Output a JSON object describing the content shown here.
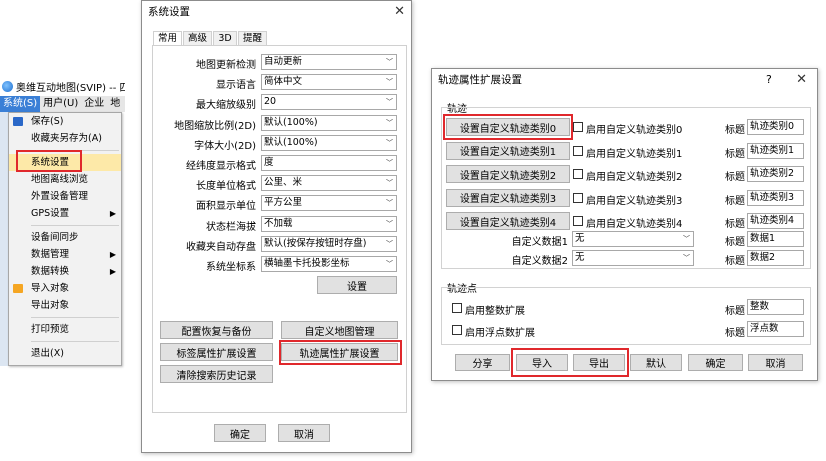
{
  "app": {
    "title": "奥维互动地图(SVIP) -- 四",
    "menubar": [
      "系统(S)",
      "用户(U)",
      "企业",
      "地"
    ]
  },
  "menu": {
    "items": [
      {
        "label": "保存(S)",
        "icon": "save-icon"
      },
      {
        "label": "收藏夹另存为(A)"
      },
      {
        "label": "系统设置"
      },
      {
        "label": "地图离线浏览"
      },
      {
        "label": "外置设备管理"
      },
      {
        "label": "GPS设置",
        "submenu": true
      },
      {
        "label": "设备间同步"
      },
      {
        "label": "数据管理",
        "submenu": true
      },
      {
        "label": "数据转换",
        "submenu": true
      },
      {
        "label": "导入对象",
        "icon": "import-icon"
      },
      {
        "label": "导出对象"
      },
      {
        "label": "打印预览"
      },
      {
        "label": "退出(X)"
      }
    ]
  },
  "sys": {
    "title": "系统设置",
    "close": "✕",
    "tabs": [
      "常用",
      "高级",
      "3D",
      "提醒"
    ],
    "rows": [
      {
        "label": "地图更新检测",
        "value": "自动更新"
      },
      {
        "label": "显示语言",
        "value": "简体中文"
      },
      {
        "label": "最大缩放级别",
        "value": "20"
      },
      {
        "label": "地图缩放比例(2D)",
        "value": "默认(100%)"
      },
      {
        "label": "字体大小(2D)",
        "value": "默认(100%)"
      },
      {
        "label": "经纬度显示格式",
        "value": "度"
      },
      {
        "label": "长度单位格式",
        "value": "公里、米"
      },
      {
        "label": "面积显示单位",
        "value": "平方公里"
      },
      {
        "label": "状态栏海拔",
        "value": "不加载"
      },
      {
        "label": "收藏夹自动存盘",
        "value": "默认(按保存按钮时存盘)"
      },
      {
        "label": "系统坐标系",
        "value": "横轴墨卡托投影坐标"
      }
    ],
    "setting_btn": "设置",
    "btns": [
      "配置恢复与备份",
      "自定义地图管理",
      "标签属性扩展设置",
      "轨迹属性扩展设置",
      "清除搜索历史记录"
    ],
    "ok": "确定",
    "cancel": "取消"
  },
  "track": {
    "title": "轨迹属性扩展设置",
    "help": "?",
    "close": "✕",
    "group1": "轨迹",
    "rows": [
      {
        "btn": "设置自定义轨迹类别0",
        "cb": "启用自定义轨迹类别0",
        "tlabel": "标题",
        "title": "轨迹类别0"
      },
      {
        "btn": "设置自定义轨迹类别1",
        "cb": "启用自定义轨迹类别1",
        "tlabel": "标题",
        "title": "轨迹类别1"
      },
      {
        "btn": "设置自定义轨迹类别2",
        "cb": "启用自定义轨迹类别2",
        "tlabel": "标题",
        "title": "轨迹类别2"
      },
      {
        "btn": "设置自定义轨迹类别3",
        "cb": "启用自定义轨迹类别3",
        "tlabel": "标题",
        "title": "轨迹类别3"
      },
      {
        "btn": "设置自定义轨迹类别4",
        "cb": "启用自定义轨迹类别4",
        "tlabel": "标题",
        "title": "轨迹类别4"
      }
    ],
    "data": [
      {
        "label": "自定义数据1",
        "value": "无",
        "tlabel": "标题",
        "title": "数据1"
      },
      {
        "label": "自定义数据2",
        "value": "无",
        "tlabel": "标题",
        "title": "数据2"
      }
    ],
    "group2": "轨迹点",
    "points": [
      {
        "cb": "启用整数扩展",
        "tlabel": "标题",
        "title": "整数"
      },
      {
        "cb": "启用浮点数扩展",
        "tlabel": "标题",
        "title": "浮点数"
      }
    ],
    "footer": [
      "分享",
      "导入",
      "导出",
      "默认",
      "确定",
      "取消"
    ]
  }
}
